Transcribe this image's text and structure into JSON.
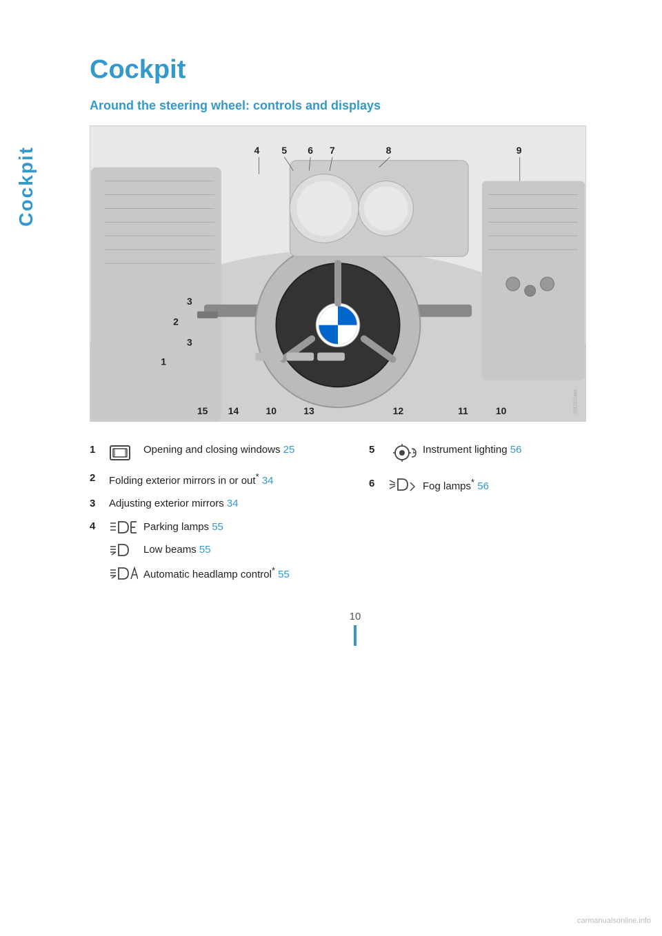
{
  "sidebar": {
    "label": "Cockpit"
  },
  "page": {
    "title": "Cockpit",
    "subtitle": "Around the steering wheel: controls and displays",
    "page_number": "10"
  },
  "diagram": {
    "numbers": [
      "1",
      "2",
      "3",
      "4",
      "5",
      "6",
      "7",
      "8",
      "9",
      "10",
      "10",
      "11",
      "12",
      "13",
      "14",
      "15"
    ]
  },
  "items": [
    {
      "number": "1",
      "icon": "window-icon",
      "text": "Opening and closing windows",
      "page_ref": "25",
      "asterisk": false,
      "sub_items": []
    },
    {
      "number": "2",
      "icon": null,
      "text": "Folding exterior mirrors in or out",
      "page_ref": "34",
      "asterisk": true,
      "sub_items": []
    },
    {
      "number": "3",
      "icon": null,
      "text": "Adjusting exterior mirrors",
      "page_ref": "34",
      "asterisk": false,
      "sub_items": []
    },
    {
      "number": "4",
      "icon": "parking-icon",
      "text": "Parking lamps",
      "page_ref": "55",
      "asterisk": false,
      "sub_items": [
        {
          "icon": "low-beam-icon",
          "text": "Low beams",
          "page_ref": "55",
          "asterisk": false
        },
        {
          "icon": "auto-headlamp-icon",
          "text": "Automatic headlamp control",
          "page_ref": "55",
          "asterisk": true
        }
      ]
    }
  ],
  "items_right": [
    {
      "number": "5",
      "icon": "instrument-icon",
      "text": "Instrument lighting",
      "page_ref": "56",
      "asterisk": false
    },
    {
      "number": "6",
      "icon": "fog-icon",
      "text": "Fog lamps",
      "page_ref": "56",
      "asterisk": true
    }
  ]
}
